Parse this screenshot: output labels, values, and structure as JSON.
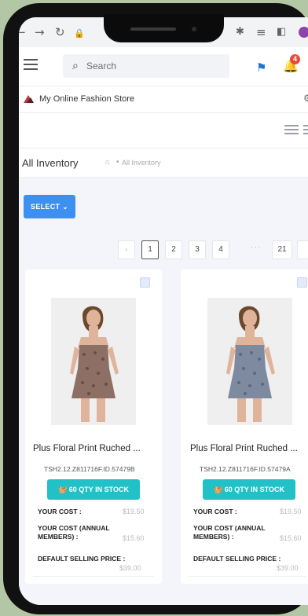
{
  "browser": {
    "icons": [
      "back-arrow-icon",
      "forward-arrow-icon",
      "reload-icon",
      "lock-icon",
      "extensions-icon",
      "reading-list-icon",
      "side-panel-icon",
      "profile-icon"
    ]
  },
  "header": {
    "search_placeholder": "Search",
    "notification_count": "4",
    "flag_color": "#1976d2"
  },
  "store": {
    "name": "My Online Fashion Store"
  },
  "page": {
    "title": "All Inventory",
    "breadcrumb_separator": "•",
    "breadcrumb_current": "All Inventory"
  },
  "select_button": {
    "label": "SELECT"
  },
  "pagination": {
    "pages": [
      "1",
      "2",
      "3",
      "4",
      "21"
    ],
    "ellipsis": "···",
    "active_page": "1"
  },
  "products": [
    {
      "title": "Plus Floral Print Ruched ...",
      "sku": "TSH2.12.Z811716F.ID.57479B",
      "stock_label": "60 QTY IN STOCK",
      "your_cost_label": "YOUR COST :",
      "your_cost_value": "$19.50",
      "annual_cost_label_1": "YOUR COST (ANNUAL",
      "annual_cost_label_2": "MEMBERS) :",
      "annual_cost_value": "$15.60",
      "selling_price_label": "DEFAULT SELLING PRICE :",
      "selling_price_value": "$39.00",
      "dress_color": "#8d6f66"
    },
    {
      "title": "Plus Floral Print Ruched ...",
      "sku": "TSH2.12.Z811716F.ID.57479A",
      "stock_label": "60 QTY IN STOCK",
      "your_cost_label": "YOUR COST :",
      "your_cost_value": "$19.50",
      "annual_cost_label_1": "YOUR COST (ANNUAL",
      "annual_cost_label_2": "MEMBERS) :",
      "annual_cost_value": "$15.60",
      "selling_price_label": "DEFAULT SELLING PRICE :",
      "selling_price_value": "$39.00",
      "dress_color": "#7d8aa0"
    }
  ],
  "colors": {
    "accent": "#3d8ff0",
    "stock": "#22c0c7",
    "badge": "#e84a3c"
  }
}
